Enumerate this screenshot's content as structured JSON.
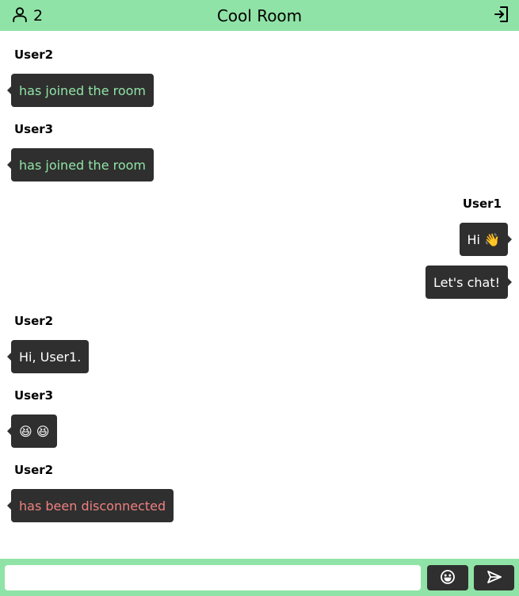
{
  "header": {
    "user_count": "2",
    "room_title": "Cool Room"
  },
  "messages": [
    {
      "author": "User2",
      "text": "has joined the room",
      "side": "left",
      "kind": "system-join"
    },
    {
      "author": "User3",
      "text": "has joined the room",
      "side": "left",
      "kind": "system-join"
    },
    {
      "author": "User1",
      "text": "Hi 👋",
      "side": "right",
      "kind": "message"
    },
    {
      "author": "",
      "text": "Let's chat!",
      "side": "right",
      "kind": "message"
    },
    {
      "author": "User2",
      "text": "Hi, User1.",
      "side": "left",
      "kind": "message"
    },
    {
      "author": "User3",
      "text": "😆 😆",
      "side": "left",
      "kind": "message"
    },
    {
      "author": "User2",
      "text": "has been disconnected",
      "side": "left",
      "kind": "system-leave"
    }
  ],
  "composer": {
    "value": "",
    "placeholder": ""
  },
  "icons": {
    "users": "user-icon",
    "exit": "logout-icon",
    "emoji": "smiley-icon",
    "send": "send-icon"
  },
  "colors": {
    "accent": "#90e3a6",
    "bubble": "#2f2f2f",
    "join_text": "#90e3a6",
    "leave_text": "#f08080"
  }
}
